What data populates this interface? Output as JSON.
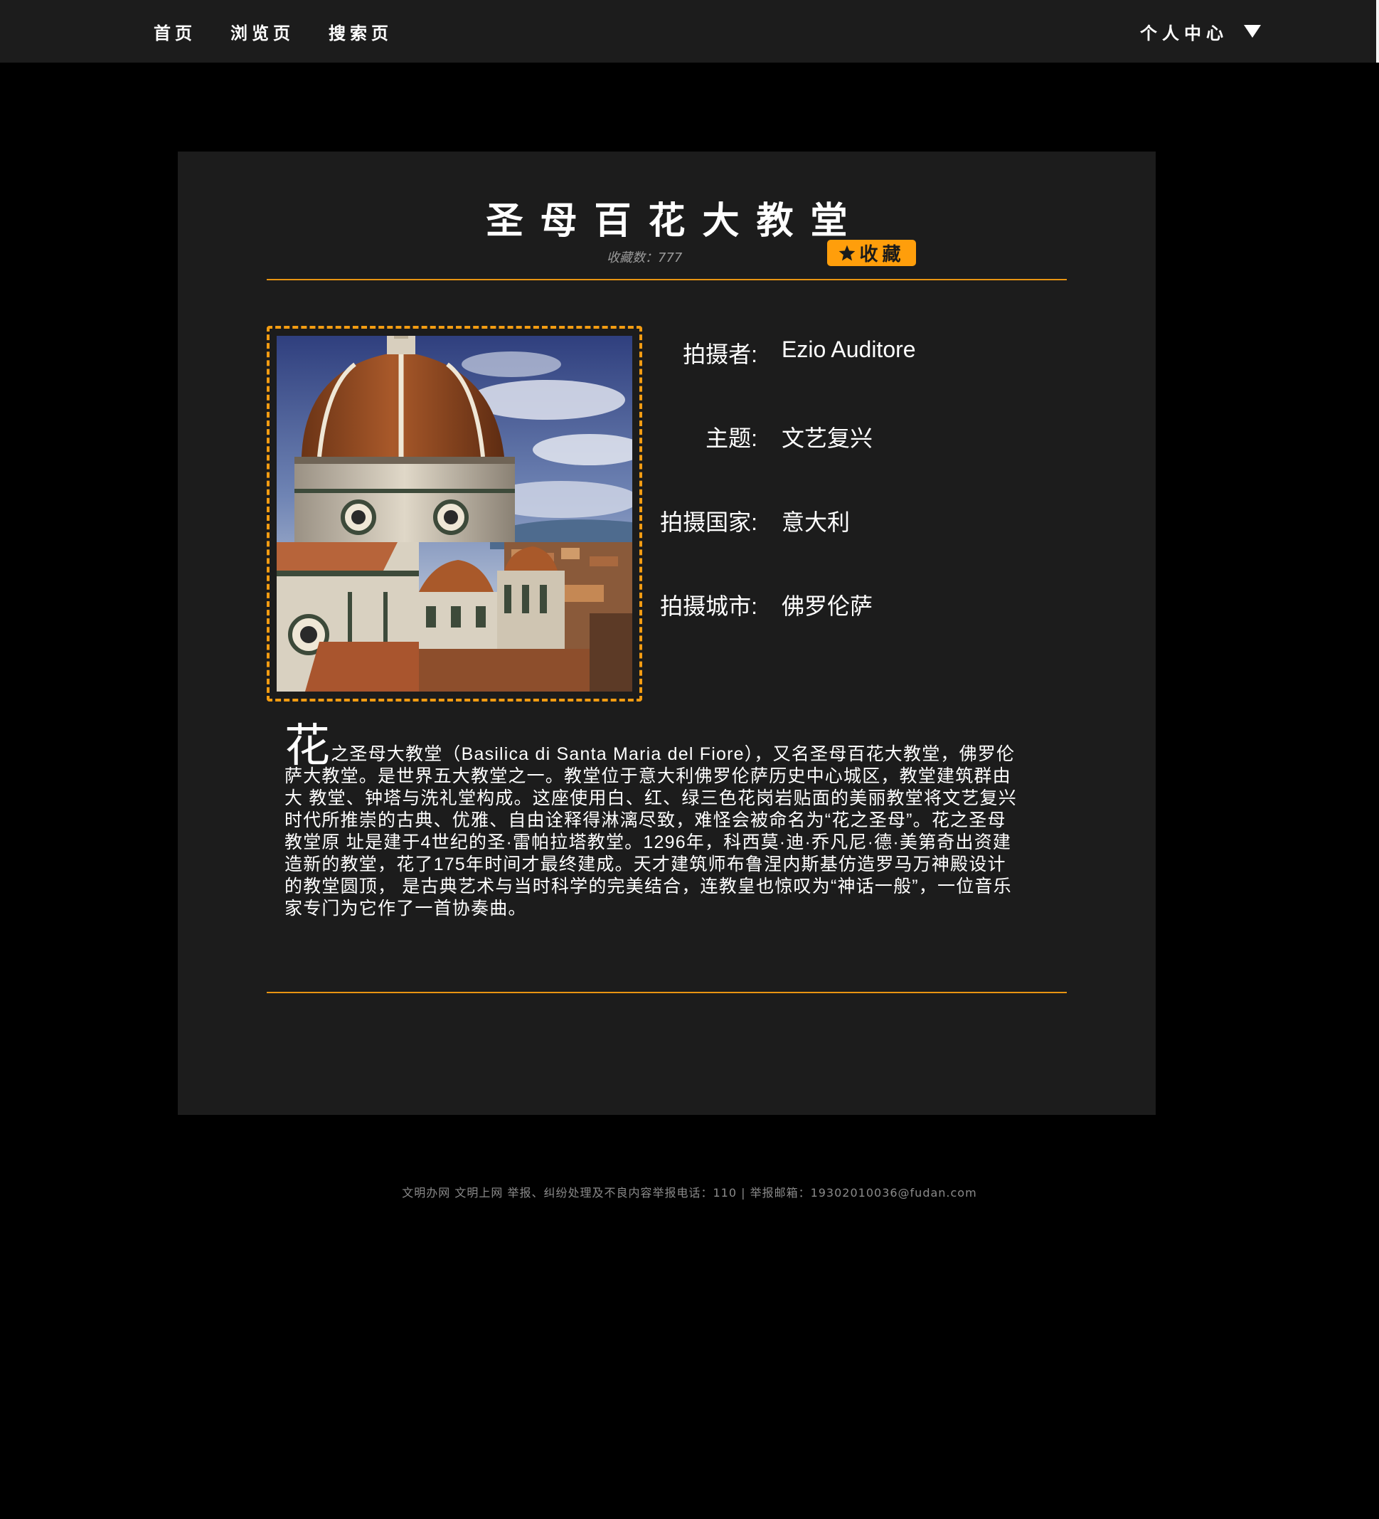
{
  "nav": {
    "links": [
      "首页",
      "浏览页",
      "搜索页"
    ],
    "user_menu": "个人中心",
    "user_menu_icon": "chevron-down-icon"
  },
  "detail": {
    "title": "圣母百花大教堂",
    "favorite_count_label": "收藏数：",
    "favorite_count": "777",
    "favorite_button": "收藏",
    "favorite_icon": "star-icon",
    "image_alt": "圣母百花大教堂",
    "info": [
      {
        "label": "拍摄者:",
        "value": "Ezio Auditore"
      },
      {
        "label": "主题:",
        "value": "文艺复兴"
      },
      {
        "label": "拍摄国家:",
        "value": "意大利"
      },
      {
        "label": "拍摄城市:",
        "value": "佛罗伦萨"
      }
    ],
    "description_first_char": "花",
    "description_rest": "之圣母大教堂（Basilica di Santa Maria del Fiore），又名圣母百花大教堂，佛罗伦萨大教堂。是世界五大教堂之一。教堂位于意大利佛罗伦萨历史中心城区，教堂建筑群由大 教堂、钟塔与洗礼堂构成。这座使用白、红、绿三色花岗岩贴面的美丽教堂将文艺复兴时代所推崇的古典、优雅、自由诠释得淋漓尽致，难怪会被命名为“花之圣母”。花之圣母教堂原 址是建于4世纪的圣·雷帕拉塔教堂。1296年，科西莫·迪·乔凡尼·德·美第奇出资建造新的教堂，花了175年时间才最终建成。天才建筑师布鲁涅内斯基仿造罗马万神殿设计的教堂圆顶， 是古典艺术与当时科学的完美结合，连教皇也惊叹为“神话一般”，一位音乐家专门为它作了一首协奏曲。"
  },
  "footer": {
    "text": "文明办网 文明上网 举报、纠纷处理及不良内容举报电话：110 | 举报邮箱：19302010036@fudan.com"
  },
  "colors": {
    "accent": "#f39c12",
    "button": "#ff9e0b",
    "panel": "#1c1c1c",
    "background": "#000000"
  }
}
